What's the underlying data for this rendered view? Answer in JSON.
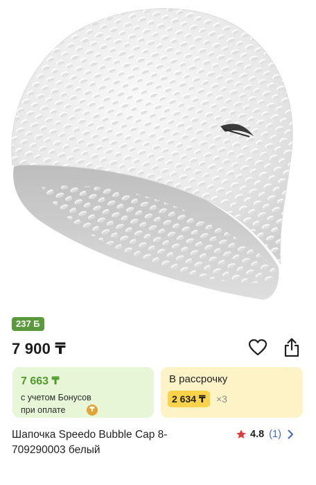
{
  "product": {
    "bonus_badge": "237 Б",
    "price": "7 900 ₸",
    "title": "Шапочка Speedo Bubble Cap 8-709290003 белый",
    "image_icon": "product-photo-swim-cap"
  },
  "bonus_card": {
    "amount": "7 663 ₸",
    "line1": "с учетом Бонусов",
    "line2": "при оплате",
    "coin_icon": "coin-icon"
  },
  "installment_card": {
    "title": "В рассрочку",
    "amount": "2 634 ₸",
    "multiplier": "×3"
  },
  "rating": {
    "value": "4.8",
    "count": "(1)"
  },
  "colors": {
    "bonus_green": "#5b9a3c",
    "bonus_card_bg": "#e6f6d7",
    "installment_bg": "#fdf3c6",
    "installment_pill": "#fad34a",
    "star_red": "#e0393e",
    "link_blue": "#3f66c8"
  }
}
